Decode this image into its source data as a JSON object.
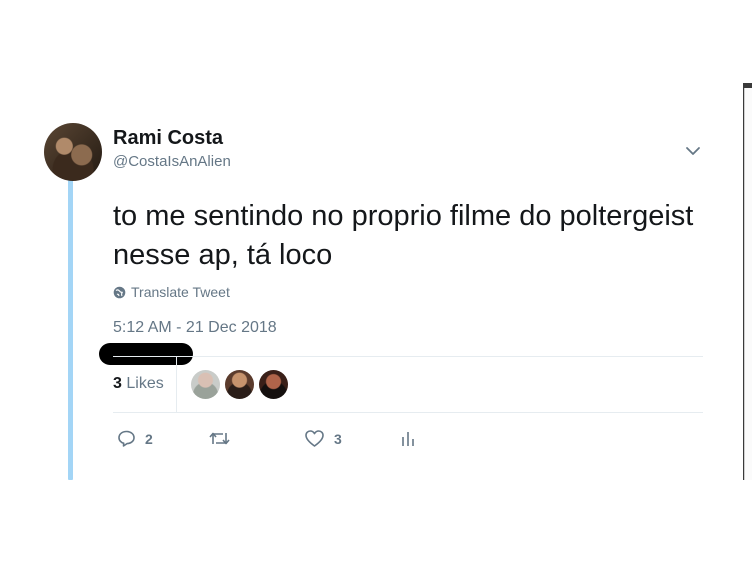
{
  "tweet": {
    "author": {
      "display_name": "Rami Costa",
      "handle": "@CostaIsAnAlien",
      "avatar_icon": "user-avatar"
    },
    "text": "to me sentindo no proprio filme do poltergeist nesse ap, tá loco",
    "translate_label": "Translate Tweet",
    "timestamp": "5:12 AM - 21 Dec 2018",
    "likes": {
      "count": "3",
      "label": "Likes"
    },
    "actions": {
      "reply_count": "2",
      "retweet_count": "",
      "like_count": "3"
    }
  },
  "colors": {
    "thread_line": "#a3d5f6",
    "secondary_text": "#657786",
    "primary_text": "#14171a"
  }
}
